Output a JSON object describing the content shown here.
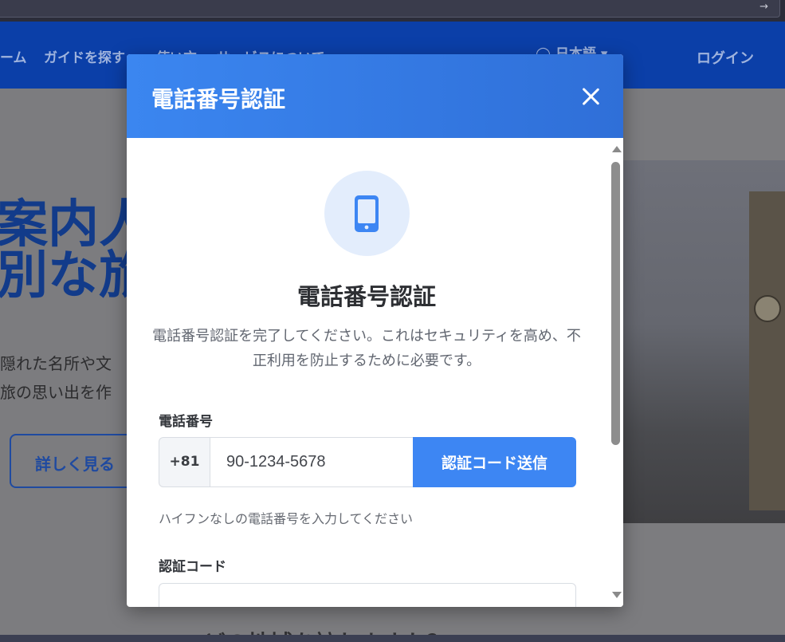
{
  "browser": {
    "go_icon": "arrow-right-icon",
    "go_glyph": "→"
  },
  "header": {
    "nav_partial": "ーム",
    "nav_guides": "ガイドを探す",
    "nav_usage": "使い方",
    "nav_services": "サービスについて",
    "language": "日本語",
    "language_glyph": "◯",
    "language_caret": "▾",
    "login": "ログイン"
  },
  "hero": {
    "title_line1": "案内人",
    "title_line2": "別な旅",
    "sub_line1": "隠れた名所や文",
    "sub_line2": "旅の思い出を作",
    "button": "詳しく見る",
    "bottom_heading": "どの地域を訪れますか？"
  },
  "modal": {
    "title": "電話番号認証",
    "close_icon": "close-icon",
    "phone_icon": "smartphone-icon",
    "heading": "電話番号認証",
    "description": "電話番号認証を完了してください。これはセキュリティを高め、不正利用を防止するために必要です。",
    "phone_label": "電話番号",
    "country_code": "+81",
    "phone_value": "90-1234-5678",
    "send_button": "認証コード送信",
    "hint": "ハイフンなしの電話番号を入力してください",
    "code_label": "認証コード",
    "code_value": ""
  },
  "colors": {
    "header_gradient_start": "#3b86f0",
    "header_gradient_end": "#2f6fd8",
    "button": "#3d86f3",
    "icon_blue": "#3d86f3",
    "icon_bg": "#e3edfc"
  }
}
